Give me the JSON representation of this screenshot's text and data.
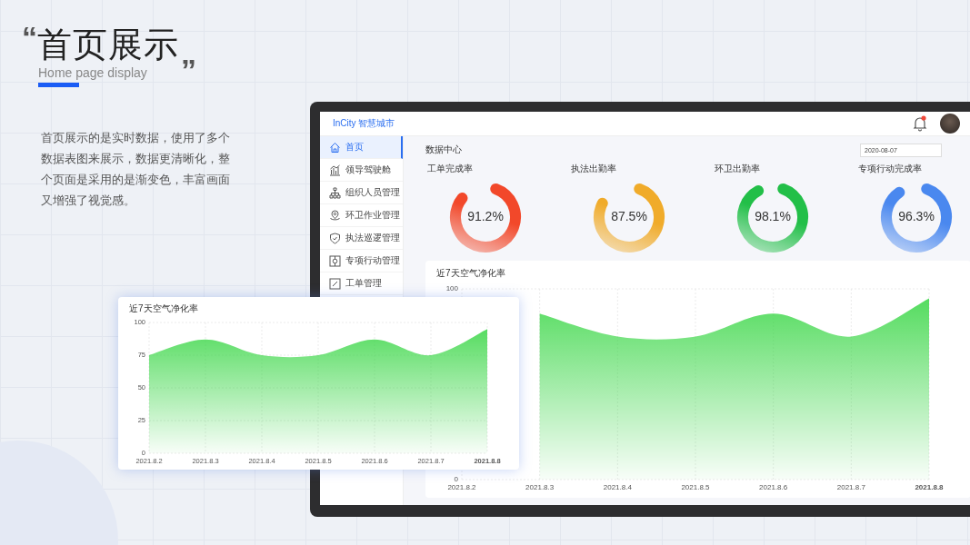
{
  "slide": {
    "open_quote": "“",
    "title": "首页展示",
    "close_quote": "”",
    "subtitle": "Home page display",
    "description": "首页展示的是实时数据，使用了多个数据表图来展示，数据更清晰化，整个页面是采用的是渐变色，丰富画面又增强了视觉感。"
  },
  "app": {
    "brand": "InCity 智慧城市",
    "sidebar": [
      {
        "label": "首页",
        "selected": true
      },
      {
        "label": "领导驾驶舱",
        "selected": false
      },
      {
        "label": "组织人员管理",
        "selected": false
      },
      {
        "label": "环卫作业管理",
        "selected": false
      },
      {
        "label": "执法巡逻管理",
        "selected": false
      },
      {
        "label": "专项行动管理",
        "selected": false
      },
      {
        "label": "工单管理",
        "selected": false
      }
    ],
    "section_title": "数据中心",
    "date": "2020-08-07",
    "gauges": [
      {
        "label": "工单完成率",
        "value": "91.2%",
        "level": 0.912,
        "color": "#f2482a"
      },
      {
        "label": "执法出勤率",
        "value": "87.5%",
        "level": 0.875,
        "color": "#f0ab2a"
      },
      {
        "label": "环卫出勤率",
        "value": "98.1%",
        "level": 0.981,
        "color": "#22bf48"
      },
      {
        "label": "专项行动完成率",
        "value": "96.3%",
        "level": 0.963,
        "color": "#4a88ef"
      }
    ],
    "chart": {
      "chart_data": {
        "type": "area",
        "title": "近7天空气净化率",
        "categories": [
          "2021.8.2",
          "2021.8.3",
          "2021.8.4",
          "2021.8.5",
          "2021.8.6",
          "2021.8.7",
          "2021.8.8"
        ],
        "series": [
          {
            "color": "#2fd43c",
            "values": [
              null,
              87,
              75,
              75,
              87,
              75,
              95
            ]
          }
        ],
        "ylim": [
          0,
          100
        ],
        "yticks": [
          0,
          100
        ],
        "grid": true
      }
    }
  },
  "overlay_card": {
    "chart_data": {
      "type": "area",
      "title": "近7天空气净化率",
      "categories": [
        "2021.8.2",
        "2021.8.3",
        "2021.8.4",
        "2021.8.5",
        "2021.8.6",
        "2021.8.7",
        "2021.8.8"
      ],
      "series": [
        {
          "color": "#2fd43c",
          "values": [
            75,
            87,
            75,
            75,
            87,
            75,
            95
          ]
        }
      ],
      "ylim": [
        0,
        100
      ],
      "yticks": [
        0,
        25,
        50,
        75,
        100
      ],
      "grid": true
    }
  }
}
